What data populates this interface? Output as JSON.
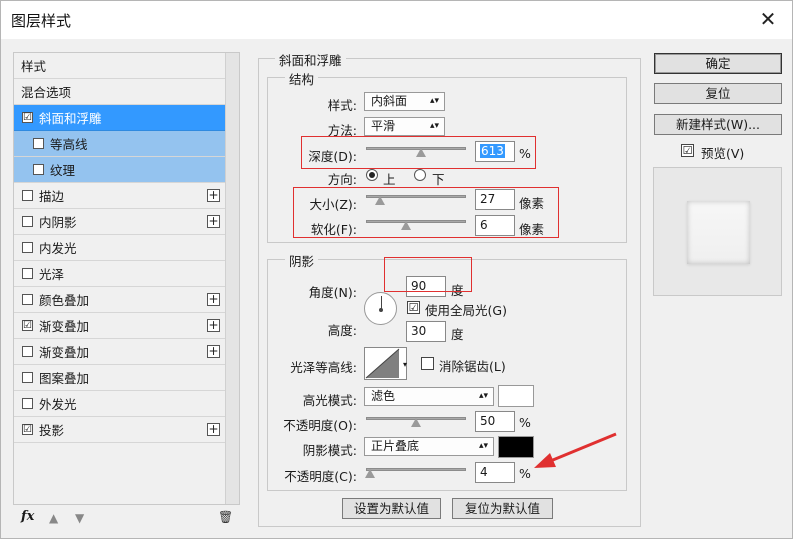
{
  "window": {
    "title": "图层样式",
    "close_icon": "close-icon"
  },
  "style_list": {
    "items": [
      {
        "label": "样式",
        "header": true
      },
      {
        "label": "混合选项",
        "header": true
      },
      {
        "label": "斜面和浮雕",
        "checked": true,
        "active": true
      },
      {
        "label": "等高线",
        "checked": false,
        "sub": true
      },
      {
        "label": "纹理",
        "checked": false,
        "sub": true
      },
      {
        "label": "描边",
        "checked": false,
        "plus": true
      },
      {
        "label": "内阴影",
        "checked": false,
        "plus": true
      },
      {
        "label": "内发光",
        "checked": false
      },
      {
        "label": "光泽",
        "checked": false
      },
      {
        "label": "颜色叠加",
        "checked": false,
        "plus": true
      },
      {
        "label": "渐变叠加",
        "checked": true,
        "plus": true
      },
      {
        "label": "渐变叠加",
        "checked": false,
        "plus": true
      },
      {
        "label": "图案叠加",
        "checked": false
      },
      {
        "label": "外发光",
        "checked": false
      },
      {
        "label": "投影",
        "checked": true,
        "plus": true
      }
    ],
    "footer": {
      "fx": "fx",
      "check_mark": "☑"
    }
  },
  "bevel": {
    "section_title": "斜面和浮雕",
    "structure": {
      "title": "结构",
      "style_label": "样式:",
      "style_value": "内斜面",
      "technique_label": "方法:",
      "technique_value": "平滑",
      "depth_label": "深度(D):",
      "depth_value": "613",
      "depth_unit": "%",
      "depth_slider": 0.55,
      "direction_label": "方向:",
      "direction_up": "上",
      "direction_down": "下",
      "size_label": "大小(Z):",
      "size_value": "27",
      "size_unit": "像素",
      "size_slider": 0.14,
      "soften_label": "软化(F):",
      "soften_value": "6",
      "soften_unit": "像素",
      "soften_slider": 0.4
    },
    "shading": {
      "title": "阴影",
      "angle_label": "角度(N):",
      "angle_value": "90",
      "angle_unit": "度",
      "global_light_label": "使用全局光(G)",
      "altitude_label": "高度:",
      "altitude_value": "30",
      "altitude_unit": "度",
      "gloss_contour_label": "光泽等高线:",
      "antialias_label": "消除锯齿(L)",
      "highlight_mode_label": "高光模式:",
      "highlight_mode_value": "滤色",
      "highlight_color": "#ffffff",
      "highlight_opacity_label": "不透明度(O):",
      "highlight_opacity_value": "50",
      "highlight_opacity_slider": 0.5,
      "shadow_mode_label": "阴影模式:",
      "shadow_mode_value": "正片叠底",
      "shadow_color": "#000000",
      "shadow_opacity_label": "不透明度(C):",
      "shadow_opacity_value": "4",
      "shadow_opacity_slider": 0.04,
      "pct": "%"
    },
    "make_default": "设置为默认值",
    "reset_default": "复位为默认值"
  },
  "buttons": {
    "ok": "确定",
    "reset": "复位",
    "new_style": "新建样式(W)...",
    "preview_label": "预览(V)"
  },
  "annotation_color": "#e03030"
}
